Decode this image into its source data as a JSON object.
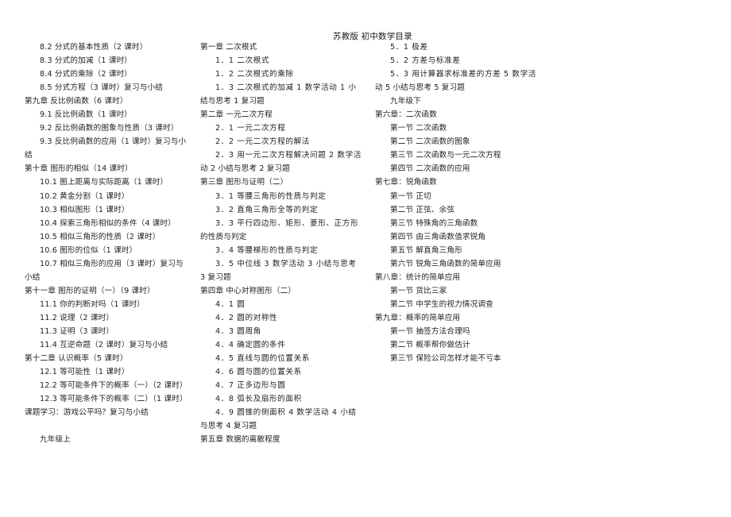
{
  "document": {
    "title": "苏教版  初中数学目录",
    "columns": [
      {
        "lines": [
          {
            "text": "8.2 分式的基本性质（2 课时）",
            "indent": true
          },
          {
            "text": "8.3 分式的加减（1 课时）",
            "indent": true
          },
          {
            "text": "8.4 分式的乘除（2 课时）",
            "indent": true
          },
          {
            "text": "8.5 分式方程（3 课时）复习与小结",
            "indent": true
          },
          {
            "text": "第九章  反比例函数（6 课时）",
            "indent": false
          },
          {
            "text": "9.1 反比例函数（1 课时）",
            "indent": true
          },
          {
            "text": "9.2 反比例函数的图象与性质（3 课时）",
            "indent": true
          },
          {
            "text": "9.3 反比例函数的应用（1 课时）复习与小",
            "indent": true
          },
          {
            "text": "结",
            "indent": false
          },
          {
            "text": "第十章  图形的相似（14 课时）",
            "indent": false
          },
          {
            "text": "10.1 图上距离与实际距离（1 课时）",
            "indent": true
          },
          {
            "text": "10.2 黄金分割（1 课时）",
            "indent": true
          },
          {
            "text": "10.3 相似图形（1 课时）",
            "indent": true
          },
          {
            "text": "10.4 探索三角形相似的条件（4 课时）",
            "indent": true
          },
          {
            "text": "10.5 相似三角形的性质（2 课时）",
            "indent": true
          },
          {
            "text": "10.6 图形的位似（1 课时）",
            "indent": true
          },
          {
            "text": "10.7 相似三角形的应用（3 课时）复习与",
            "indent": true
          },
          {
            "text": "小结",
            "indent": false
          },
          {
            "text": "第十一章  图形的证明（一）（9 课时）",
            "indent": false
          },
          {
            "text": "11.1 你的判断对吗（1 课时）",
            "indent": true
          },
          {
            "text": "11.2 说理（2 课时）",
            "indent": true
          },
          {
            "text": "11.3 证明（3 课时）",
            "indent": true
          },
          {
            "text": "11.4 互逆命题（2 课时）复习与小结",
            "indent": true
          },
          {
            "text": "第十二章  认识概率（5 课时）",
            "indent": false
          },
          {
            "text": "12.1 等可能性（1 课时）",
            "indent": true
          },
          {
            "text": "12.2 等可能条件下的概率（一）（2 课时）",
            "indent": true
          },
          {
            "text": "12.3 等可能条件下的概率（二）（1 课时）",
            "indent": true
          },
          {
            "text": "课题学习：游戏公平吗？复习与小结",
            "indent": false
          },
          {
            "text": "",
            "indent": false
          },
          {
            "text": "九年级上",
            "indent": true
          }
        ]
      },
      {
        "lines": [
          {
            "text": "第一章  二次根式",
            "indent": false
          },
          {
            "text": "1．1  二次根式",
            "indent": true
          },
          {
            "text": "1．2  二次根式的乘除",
            "indent": true
          },
          {
            "text": "1．3  二次根式的加减  1  数学活动  1  小",
            "indent": true
          },
          {
            "text": "结与思考  1  复习题",
            "indent": false
          },
          {
            "text": "第二章  一元二次方程",
            "indent": false
          },
          {
            "text": "2．1  一元二次方程",
            "indent": true
          },
          {
            "text": "2．2  一元二次方程的解法",
            "indent": true
          },
          {
            "text": "2．3  用一元二次方程解决问题  2  数学活",
            "indent": true
          },
          {
            "text": "动  2  小结与思考  2  复习题",
            "indent": false
          },
          {
            "text": "第三章  图形与证明（二）",
            "indent": false
          },
          {
            "text": "3．1  等腰三角形的性质与判定",
            "indent": true
          },
          {
            "text": "3．2  直角三角形全等的判定",
            "indent": true
          },
          {
            "text": "3．3  平行四边形、矩形、菱形、正方形",
            "indent": true
          },
          {
            "text": "的性质与判定",
            "indent": false
          },
          {
            "text": "3．4  等腰梯形的性质与判定",
            "indent": true
          },
          {
            "text": "3．5  中位线  3  数学活动  3  小结与思考",
            "indent": true
          },
          {
            "text": "3  复习题",
            "indent": false
          },
          {
            "text": "第四章  中心对称图形（二）",
            "indent": false
          },
          {
            "text": "4．1  圆",
            "indent": true
          },
          {
            "text": "4．2  圆的对称性",
            "indent": true
          },
          {
            "text": "4．3  圆周角",
            "indent": true
          },
          {
            "text": "4．4  确定圆的条件",
            "indent": true
          },
          {
            "text": "4．5  直线与圆的位置关系",
            "indent": true
          },
          {
            "text": "4．6  圆与圆的位置关系",
            "indent": true
          },
          {
            "text": "4．7  正多边形与圆",
            "indent": true
          },
          {
            "text": "4．8  弧长及扇形的面积",
            "indent": true
          },
          {
            "text": "4．9  圆锥的侧面积  4  数学活动  4  小结",
            "indent": true
          },
          {
            "text": "与思考  4  复习题",
            "indent": false
          },
          {
            "text": "第五章  数据的离散程度",
            "indent": false
          }
        ]
      },
      {
        "lines": [
          {
            "text": "5．1  极差",
            "indent": true
          },
          {
            "text": "5．2  方差与标准差",
            "indent": true
          },
          {
            "text": "5．3  用计算器求标准差的方差  5  数学活",
            "indent": true
          },
          {
            "text": "动  5  小结与思考  5  复习题",
            "indent": false
          },
          {
            "text": "九年级下",
            "indent": true
          },
          {
            "text": "第六章：二次函数",
            "indent": false
          },
          {
            "text": "第一节  二次函数",
            "indent": true
          },
          {
            "text": "第二节  二次函数的图象",
            "indent": true
          },
          {
            "text": "第三节  二次函数与一元二次方程",
            "indent": true
          },
          {
            "text": "第四节  二次函数的应用",
            "indent": true
          },
          {
            "text": "第七章：锐角函数",
            "indent": false
          },
          {
            "text": "第一节  正切",
            "indent": true
          },
          {
            "text": "第二节  正弦、余弦",
            "indent": true
          },
          {
            "text": "第三节  特殊角的三角函数",
            "indent": true
          },
          {
            "text": "第四节  由三角函数值求锐角",
            "indent": true
          },
          {
            "text": "第五节  解直角三角形",
            "indent": true
          },
          {
            "text": "第六节  锐角三角函数的简单应用",
            "indent": true
          },
          {
            "text": "第八章：统计的简单应用",
            "indent": false
          },
          {
            "text": "第一节  货比三家",
            "indent": true
          },
          {
            "text": "第二节  中学生的视力情况调查",
            "indent": true
          },
          {
            "text": "第九章：概率的简单应用",
            "indent": false
          },
          {
            "text": "第一节  抽签方法合理吗",
            "indent": true
          },
          {
            "text": "第二节  概率帮你做估计",
            "indent": true
          },
          {
            "text": "第三节  保险公司怎样才能不亏本",
            "indent": true
          }
        ]
      }
    ]
  }
}
